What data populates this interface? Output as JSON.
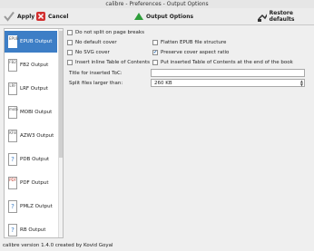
{
  "window": {
    "title": "calibre - Preferences - Output Options"
  },
  "toolbar": {
    "apply_label": "Apply",
    "cancel_label": "Cancel",
    "section_label": "Output Options",
    "restore_label": "Restore defaults"
  },
  "sidebar": {
    "items": [
      {
        "label": "EPUB Output",
        "icon_text": "EPUB",
        "active": true
      },
      {
        "label": "FB2 Output",
        "icon_text": "FB2"
      },
      {
        "label": "LRF Output",
        "icon_text": "LRF"
      },
      {
        "label": "MOBI Output",
        "icon_text": "mobi"
      },
      {
        "label": "AZW3 Output",
        "icon_text": "KF8"
      },
      {
        "label": "PDB Output",
        "icon_text": "?"
      },
      {
        "label": "PDF Output",
        "icon_text": "PDF"
      },
      {
        "label": "PMLZ Output",
        "icon_text": "?"
      },
      {
        "label": "RB Output",
        "icon_text": "?"
      }
    ]
  },
  "options": {
    "do_not_split": {
      "label": "Do not split on page breaks",
      "checked": false
    },
    "no_default_cover": {
      "label": "No default cover",
      "checked": false
    },
    "flatten_epub": {
      "label": "Flatten EPUB file structure",
      "checked": false
    },
    "no_svg_cover": {
      "label": "No SVG cover",
      "checked": false
    },
    "preserve_aspect": {
      "label": "Preserve cover aspect ratio",
      "checked": true
    },
    "insert_inline_toc": {
      "label": "Insert inline Table of Contents",
      "checked": false
    },
    "toc_at_end": {
      "label": "Put inserted Table of Contents at the end of the book",
      "checked": false
    },
    "toc_title": {
      "label": "Title for inserted ToC:",
      "value": ""
    },
    "split_size": {
      "label": "Split files larger than:",
      "value": "260 KB"
    }
  },
  "status": {
    "text": "calibre version 1.4.0 created by Kovid Goyal"
  },
  "colors": {
    "selection": "#3d7ec6",
    "apply_green": "#2e9e3a",
    "cancel_red": "#d23030"
  }
}
